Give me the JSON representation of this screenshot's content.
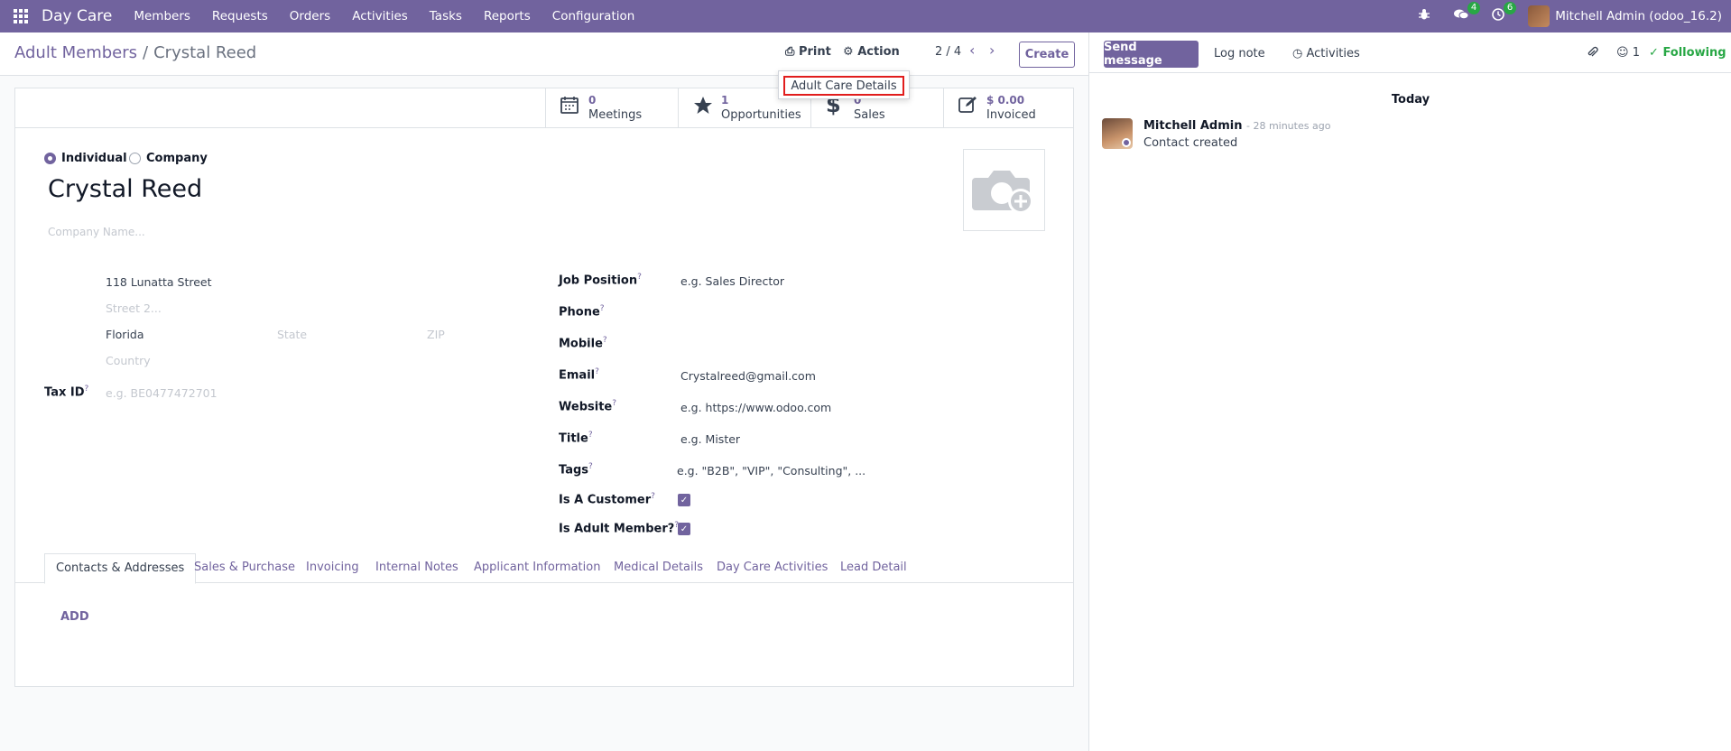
{
  "navbar": {
    "brand": "Day Care",
    "menu": [
      "Members",
      "Requests",
      "Orders",
      "Activities",
      "Tasks",
      "Reports",
      "Configuration"
    ],
    "messages_count": "4",
    "activities_count": "6",
    "user": "Mitchell Admin (odoo_16.2)"
  },
  "control": {
    "breadcrumb_parent": "Adult Members",
    "breadcrumb_sep": "/",
    "breadcrumb_current": "Crystal Reed",
    "print_label": "Print",
    "action_label": "Action",
    "pager": "2 / 4",
    "create_label": "Create"
  },
  "print_menu": {
    "item": "Adult Care Details"
  },
  "stats": [
    {
      "value": "0",
      "label": "Meetings",
      "icon": "calendar-icon"
    },
    {
      "value": "1",
      "label": "Opportunities",
      "icon": "star-icon"
    },
    {
      "value": "0",
      "label": "Sales",
      "icon": "dollar-icon"
    },
    {
      "value": "$ 0.00",
      "label": "Invoiced",
      "icon": "pencil-square-icon"
    }
  ],
  "form": {
    "type_individual": "Individual",
    "type_company": "Company",
    "name": "Crystal Reed",
    "company_placeholder": "Company Name...",
    "street": "118 Lunatta Street",
    "street2_placeholder": "Street 2...",
    "city": "Florida",
    "state_placeholder": "State",
    "zip_placeholder": "ZIP",
    "country_placeholder": "Country",
    "tax_id_label": "Tax ID",
    "tax_id_placeholder": "e.g. BE0477472701",
    "job_position_label": "Job Position",
    "job_position_placeholder": "e.g. Sales Director",
    "phone_label": "Phone",
    "mobile_label": "Mobile",
    "email_label": "Email",
    "email": "Crystalreed@gmail.com",
    "website_label": "Website",
    "website_placeholder": "e.g. https://www.odoo.com",
    "title_label": "Title",
    "title_placeholder": "e.g. Mister",
    "tags_label": "Tags",
    "tags_placeholder": "e.g. \"B2B\", \"VIP\", \"Consulting\", ...",
    "is_customer_label": "Is A Customer",
    "is_adult_member_label": "Is Adult Member?",
    "help_mark": "?"
  },
  "tabs": [
    "Contacts & Addresses",
    "Sales & Purchase",
    "Invoicing",
    "Internal Notes",
    "Applicant Information",
    "Medical Details",
    "Day Care Activities",
    "Lead Detail"
  ],
  "add_label": "ADD",
  "chatter": {
    "send_message": "Send message",
    "log_note": "Log note",
    "activities": "Activities",
    "followers_count": "1",
    "following": "Following",
    "date_separator": "Today",
    "message_author": "Mitchell Admin",
    "message_time": "- 28 minutes ago",
    "message_body": "Contact created"
  }
}
